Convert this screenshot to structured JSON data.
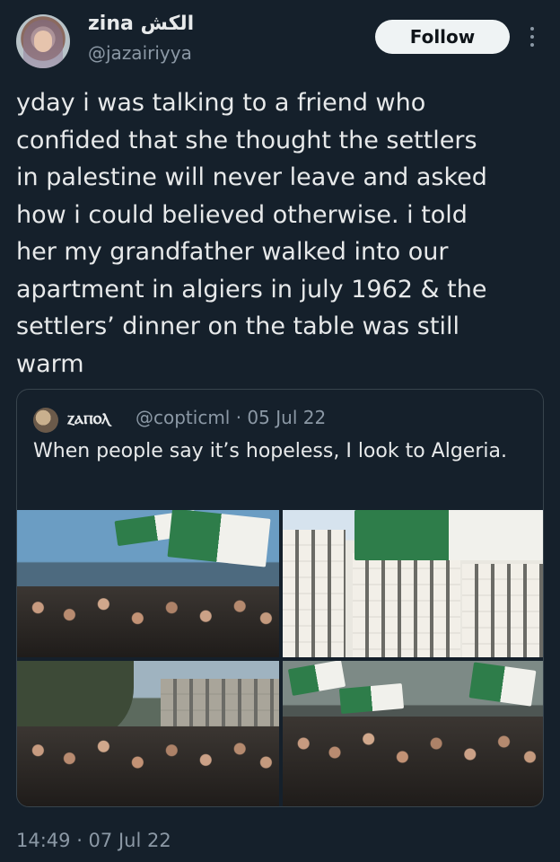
{
  "author": {
    "display_name": "zina الكش",
    "handle": "@jazairiyya"
  },
  "actions": {
    "follow_label": "Follow"
  },
  "tweet": {
    "text": "yday i was talking to a friend who\nconfided that she thought the settlers\nin palestine will never leave and asked\nhow i could believed otherwise. i told\nher my grandfather walked into our\napartment in algiers in july 1962 & the\nsettlers’ dinner on the table was still\nwarm",
    "timestamp": "14:49 · 07 Jul 22"
  },
  "quoted_tweet": {
    "display_name": "ⲍⲁⲡⲟⲗ",
    "meta": "@copticml · 05 Jul 22",
    "text": "When people say it’s hopeless, I look to Algeria."
  },
  "icons": {
    "more": "more-vertical-icon"
  },
  "colors": {
    "background": "#15202b",
    "text": "#e7e9ea",
    "muted": "#8b98a5",
    "border": "#38444d",
    "follow_bg": "#eff3f4"
  }
}
